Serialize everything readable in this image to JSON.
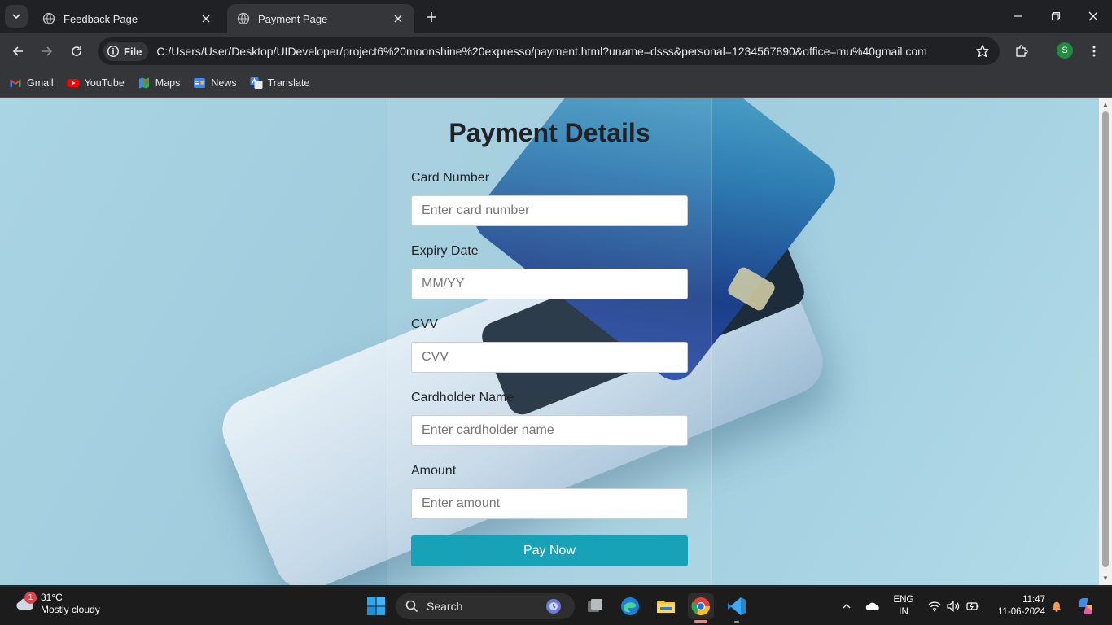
{
  "browser": {
    "tabs": [
      {
        "title": "Feedback Page",
        "active": false
      },
      {
        "title": "Payment Page",
        "active": true
      }
    ],
    "address": {
      "chip_label": "File",
      "url": "C:/Users/User/Desktop/UIDeveloper/project6%20moonshine%20expresso/payment.html?uname=dsss&personal=1234567890&office=mu%40gmail.com"
    },
    "profile_initial": "S",
    "bookmarks": [
      {
        "label": "Gmail",
        "icon": "gmail-icon"
      },
      {
        "label": "YouTube",
        "icon": "youtube-icon"
      },
      {
        "label": "Maps",
        "icon": "maps-icon"
      },
      {
        "label": "News",
        "icon": "news-icon"
      },
      {
        "label": "Translate",
        "icon": "translate-icon"
      }
    ]
  },
  "page": {
    "title": "Payment Details",
    "fields": [
      {
        "label": "Card Number",
        "placeholder": "Enter card number"
      },
      {
        "label": "Expiry Date",
        "placeholder": "MM/YY"
      },
      {
        "label": "CVV",
        "placeholder": "CVV"
      },
      {
        "label": "Cardholder Name",
        "placeholder": "Enter cardholder name"
      },
      {
        "label": "Amount",
        "placeholder": "Enter amount"
      }
    ],
    "submit_label": "Pay Now",
    "colors": {
      "button": "#17a2b8",
      "background": "#a9d4e3"
    }
  },
  "taskbar": {
    "weather": {
      "temp": "31°C",
      "condition": "Mostly cloudy",
      "badge": "1"
    },
    "search_label": "Search",
    "language": {
      "line1": "ENG",
      "line2": "IN"
    },
    "clock": {
      "time": "11:47",
      "date": "11-06-2024"
    }
  }
}
